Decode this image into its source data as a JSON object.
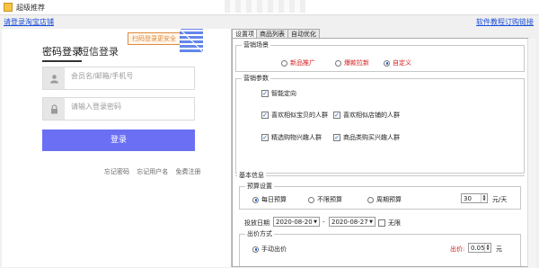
{
  "window": {
    "title": "超级推荐"
  },
  "topbar": {
    "login_link": "请登录淘宝店铺",
    "tutorial_link": "软件教程",
    "order_link": "订购链接"
  },
  "login": {
    "tab_password": "密码登录",
    "tab_sms": "短信登录",
    "qr_tip": "扫码登录更安全",
    "username_placeholder": "会员名/邮箱/手机号",
    "password_placeholder": "请输入登录密码",
    "login_button": "登录",
    "links": [
      "忘记密码",
      "忘记用户名",
      "免费注册"
    ]
  },
  "settings": {
    "tabs": [
      "设置项",
      "商品列表",
      "自动优化"
    ],
    "marketing_scene": {
      "title": "营销场景",
      "options": [
        "新品推广",
        "爆款拉新",
        "自定义"
      ],
      "selected": "自定义"
    },
    "marketing_params": {
      "title": "营销参数",
      "items": [
        {
          "label": "智能定向",
          "checked": true
        },
        {
          "label": "喜欢相似宝贝的人群",
          "checked": true
        },
        {
          "label": "喜欢相似店铺的人群",
          "checked": true
        },
        {
          "label": "精选购物兴趣人群",
          "checked": true
        },
        {
          "label": "商品类购买兴趣人群",
          "checked": true
        }
      ]
    },
    "basic_info": {
      "title": "基本信息",
      "budget": {
        "title": "预算设置",
        "options": [
          "每日预算",
          "不限预算",
          "周期预算"
        ],
        "selected": "每日预算",
        "value": "30",
        "unit": "元/天"
      },
      "delivery": {
        "label": "投放日期",
        "start": "2020-08-20",
        "separator": "-",
        "end": "2020-08-27",
        "unlimited_label": "无限"
      },
      "bidding": {
        "title": "出价方式",
        "option": "手动出价",
        "bid_label": "出价:",
        "bid_value": "0.05",
        "unit": "元"
      }
    }
  }
}
